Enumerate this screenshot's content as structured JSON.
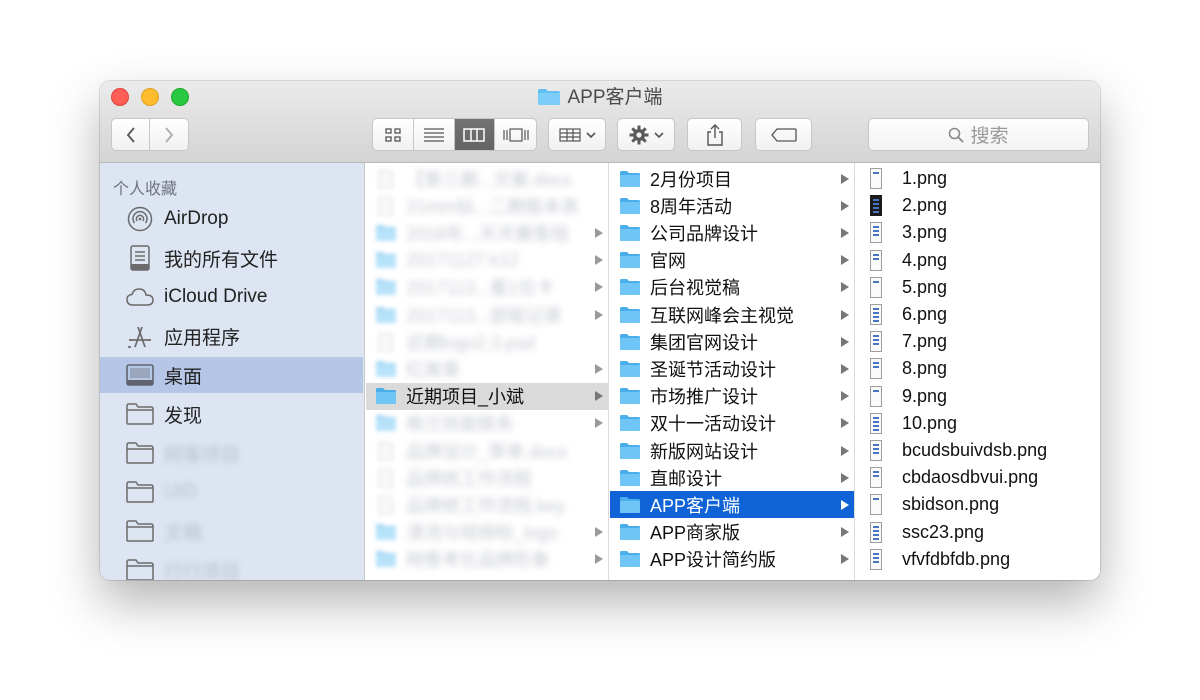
{
  "window": {
    "title": "APP客户端"
  },
  "toolbar": {
    "back": "back",
    "forward": "forward",
    "view_modes": [
      "icon-view",
      "list-view",
      "column-view",
      "cover-flow-view"
    ],
    "active_view": "column-view",
    "search_placeholder": "搜索"
  },
  "sidebar": {
    "header": "个人收藏",
    "items": [
      {
        "label": "AirDrop",
        "icon": "airdrop-icon"
      },
      {
        "label": "我的所有文件",
        "icon": "all-files-icon"
      },
      {
        "label": "iCloud Drive",
        "icon": "cloud-icon"
      },
      {
        "label": "应用程序",
        "icon": "applications-icon"
      },
      {
        "label": "桌面",
        "icon": "desktop-icon",
        "selected": true
      },
      {
        "label": "发现",
        "icon": "folder-icon"
      },
      {
        "label": "网客项目",
        "icon": "folder-icon",
        "blurred": true
      },
      {
        "label": "UID",
        "icon": "folder-icon",
        "blurred": true
      },
      {
        "label": "文稿",
        "icon": "folder-icon",
        "blurred": true
      },
      {
        "label": "行行项目",
        "icon": "folder-icon",
        "blurred": true
      }
    ]
  },
  "column1": [
    {
      "label": "【第三期...文案.docx",
      "blurred": true,
      "arrow": false,
      "icon": "doc-icon"
    },
    {
      "label": "21mm钻...二期版本表",
      "blurred": true,
      "arrow": false,
      "icon": "doc-icon"
    },
    {
      "label": "2016年...天天搬客组",
      "blurred": true,
      "arrow": true,
      "icon": "folder-icon"
    },
    {
      "label": "20171127.k12",
      "blurred": true,
      "arrow": true,
      "icon": "folder-icon"
    },
    {
      "label": "2017113...看1位卡",
      "blurred": true,
      "arrow": true,
      "icon": "folder-icon"
    },
    {
      "label": "2017113...部版记录",
      "blurred": true,
      "arrow": true,
      "icon": "folder-icon"
    },
    {
      "label": "近期logo2.3.psd",
      "blurred": true,
      "arrow": false,
      "icon": "doc-icon"
    },
    {
      "label": "红离章",
      "blurred": true,
      "arrow": true,
      "icon": "folder-icon"
    },
    {
      "label": "近期项目_小斌",
      "blurred": false,
      "arrow": true,
      "icon": "folder-icon",
      "selected": true
    },
    {
      "label": "格兰技能联系",
      "blurred": true,
      "arrow": true,
      "icon": "folder-icon"
    },
    {
      "label": "品牌设计_草单.docx",
      "blurred": true,
      "arrow": false,
      "icon": "doc-icon"
    },
    {
      "label": "品牌统工作流程",
      "blurred": true,
      "arrow": false,
      "icon": "doc-icon"
    },
    {
      "label": "品牌统工作流程.key",
      "blurred": true,
      "arrow": false,
      "icon": "doc-icon"
    },
    {
      "label": "漂流与视频标_logo",
      "blurred": true,
      "arrow": true,
      "icon": "folder-icon"
    },
    {
      "label": "网客考社品牌形象",
      "blurred": true,
      "arrow": true,
      "icon": "folder-icon"
    }
  ],
  "column2": [
    {
      "label": "2月份项目"
    },
    {
      "label": "8周年活动"
    },
    {
      "label": "公司品牌设计"
    },
    {
      "label": "官网"
    },
    {
      "label": "后台视觉稿"
    },
    {
      "label": "互联网峰会主视觉"
    },
    {
      "label": "集团官网设计"
    },
    {
      "label": "圣诞节活动设计"
    },
    {
      "label": "市场推广设计"
    },
    {
      "label": "双十一活动设计"
    },
    {
      "label": "新版网站设计"
    },
    {
      "label": "直邮设计"
    },
    {
      "label": "APP客户端",
      "selected": true
    },
    {
      "label": "APP商家版"
    },
    {
      "label": "APP设计简约版"
    }
  ],
  "column3": [
    {
      "label": "1.png"
    },
    {
      "label": "2.png"
    },
    {
      "label": "3.png"
    },
    {
      "label": "4.png"
    },
    {
      "label": "5.png"
    },
    {
      "label": "6.png"
    },
    {
      "label": "7.png"
    },
    {
      "label": "8.png"
    },
    {
      "label": "9.png"
    },
    {
      "label": "10.png"
    },
    {
      "label": "bcudsbuivdsb.png"
    },
    {
      "label": "cbdaosdbvui.png"
    },
    {
      "label": "sbidson.png"
    },
    {
      "label": "ssc23.png"
    },
    {
      "label": "vfvfdbfdb.png"
    }
  ],
  "colors": {
    "sidebar_bg": "#dde4f2",
    "sidebar_selected": "#b5c6e6",
    "selection_blue": "#0f63d6",
    "folder_blue": "#62c0f4"
  }
}
